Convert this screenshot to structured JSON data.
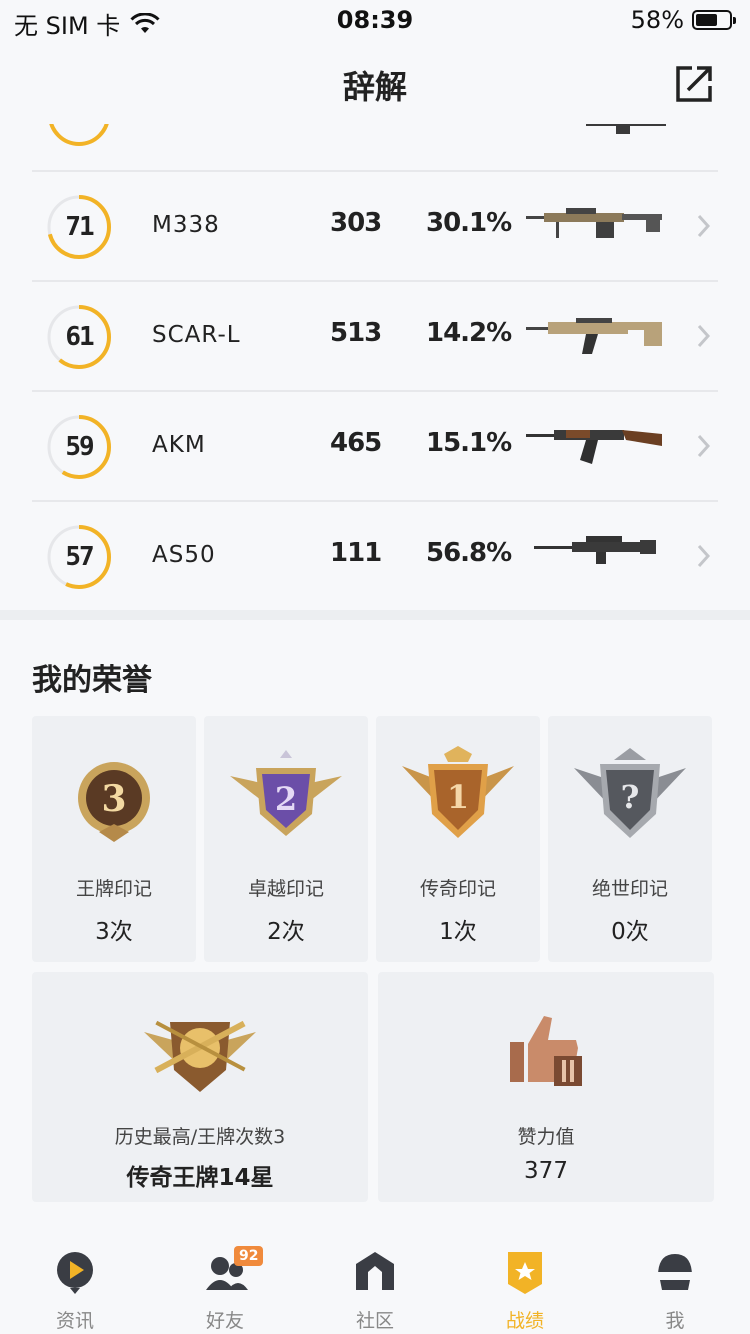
{
  "status_bar": {
    "carrier": "无 SIM 卡",
    "time": "08:39",
    "battery": "58%",
    "battery_level": 0.58
  },
  "nav": {
    "title": "辞解"
  },
  "weapons": [
    {
      "score": "71",
      "score_value": 71,
      "name": "M338",
      "kills": "303",
      "rate": "30.1%"
    },
    {
      "score": "61",
      "score_value": 61,
      "name": "SCAR-L",
      "kills": "513",
      "rate": "14.2%"
    },
    {
      "score": "59",
      "score_value": 59,
      "name": "AKM",
      "kills": "465",
      "rate": "15.1%"
    },
    {
      "score": "57",
      "score_value": 57,
      "name": "AS50",
      "kills": "111",
      "rate": "56.8%"
    }
  ],
  "honors": {
    "title": "我的荣誉",
    "marks": [
      {
        "badge_number": "3",
        "label": "王牌印记",
        "count": "3次"
      },
      {
        "badge_number": "2",
        "label": "卓越印记",
        "count": "2次"
      },
      {
        "badge_number": "1",
        "label": "传奇印记",
        "count": "1次"
      },
      {
        "badge_number": "?",
        "label": "绝世印记",
        "count": "0次"
      }
    ],
    "highest": {
      "label": "历史最高/王牌次数3",
      "value": "传奇王牌14星"
    },
    "likes": {
      "label": "赞力值",
      "value": "377"
    }
  },
  "tabs": [
    {
      "label": "资讯",
      "icon": "news-icon"
    },
    {
      "label": "好友",
      "icon": "friends-icon",
      "badge": "92"
    },
    {
      "label": "社区",
      "icon": "community-icon"
    },
    {
      "label": "战绩",
      "icon": "record-icon",
      "active": true
    },
    {
      "label": "我",
      "icon": "profile-icon"
    }
  ],
  "colors": {
    "accent": "#f2b326",
    "ring_track": "#e6e7ea",
    "badge": "#f08a3c",
    "bronze": "#a9642b",
    "purple": "#6b4ea8",
    "silver": "#8a8d93"
  }
}
